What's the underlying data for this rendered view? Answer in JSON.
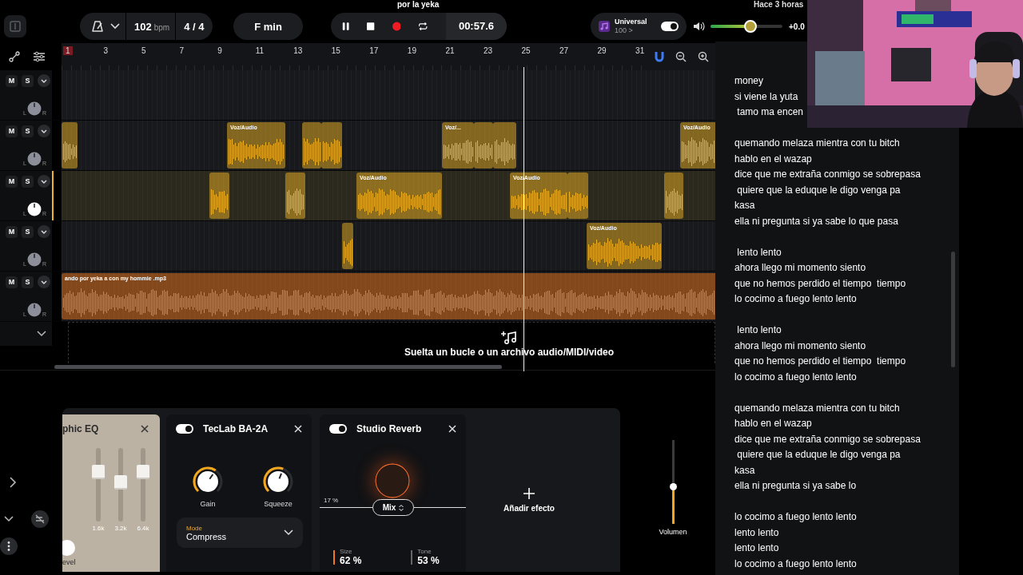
{
  "header": {
    "title": "por la yeka",
    "saved": "Hace 3 horas"
  },
  "toolbar": {
    "tempo": "102",
    "tempo_unit": "bpm",
    "time_signature": "4 / 4",
    "key": "F min",
    "playing": true,
    "time": "00:57.6",
    "preset": {
      "name": "Universal",
      "value": "100 >",
      "on": true
    },
    "master": {
      "level": 0.55,
      "reading": "+0.0"
    }
  },
  "ruler": {
    "marks": [
      {
        "label": "1",
        "highlighted": true
      },
      {
        "label": "3",
        "highlighted": false
      },
      {
        "label": "5",
        "highlighted": false
      },
      {
        "label": "7",
        "highlighted": false
      },
      {
        "label": "9",
        "highlighted": false
      },
      {
        "label": "11",
        "highlighted": false
      },
      {
        "label": "13",
        "highlighted": false
      },
      {
        "label": "15",
        "highlighted": false
      },
      {
        "label": "17",
        "highlighted": false
      },
      {
        "label": "19",
        "highlighted": false
      },
      {
        "label": "21",
        "highlighted": false
      },
      {
        "label": "23",
        "highlighted": false
      },
      {
        "label": "25",
        "highlighted": false
      },
      {
        "label": "27",
        "highlighted": false
      },
      {
        "label": "29",
        "highlighted": false
      },
      {
        "label": "31",
        "highlighted": false
      }
    ]
  },
  "tracks": [
    {
      "mute": "M",
      "solo": "S",
      "pan_left": "L",
      "pan_right": "R",
      "selected": false
    },
    {
      "mute": "M",
      "solo": "S",
      "pan_left": "L",
      "pan_right": "R",
      "selected": false,
      "color": "#f0b323",
      "clips": [
        {
          "kind": "clip"
        },
        {
          "kind": "clip",
          "label": "Voz/Audio"
        },
        {
          "kind": "clip"
        },
        {
          "kind": "clip"
        },
        {
          "kind": "clip",
          "label": "Voz/..."
        },
        {
          "kind": "clip"
        },
        {
          "kind": "clip"
        },
        {
          "kind": "clip",
          "label": "Voz/Audio"
        }
      ]
    },
    {
      "mute": "M",
      "solo": "S",
      "pan_left": "L",
      "pan_right": "R",
      "selected": true,
      "color": "#f0b323",
      "clips": [
        {
          "kind": "clip"
        },
        {
          "kind": "clip"
        },
        {
          "kind": "clip",
          "label": "Voz/Audio"
        },
        {
          "kind": "clip",
          "label": "Voz/Audio"
        },
        {
          "kind": "clip"
        },
        {
          "kind": "clip"
        }
      ]
    },
    {
      "mute": "M",
      "solo": "S",
      "pan_left": "L",
      "pan_right": "R",
      "selected": false,
      "color": "#f0b323",
      "clips": [
        {
          "kind": "clip"
        },
        {
          "kind": "clip",
          "label": "Voz/Audio"
        }
      ]
    },
    {
      "mute": "M",
      "solo": "S",
      "pan_left": "L",
      "pan_right": "R",
      "selected": false,
      "color": "#f07a1e",
      "clips": [
        {
          "kind": "clip",
          "label": "ando por yeka a con my hommie .mp3"
        }
      ]
    }
  ],
  "drop_zone": {
    "text": "Suelta un bucle o un archivo audio/MIDI/video"
  },
  "effects": [
    {
      "kind": "eq",
      "title": "phic EQ",
      "bands": [
        {
          "label": "1.6k",
          "level": 0.67
        },
        {
          "label": "3.2k",
          "level": 0.53
        },
        {
          "label": "6.4k",
          "level": 0.67
        }
      ],
      "knob_label": "evel"
    },
    {
      "kind": "compressor",
      "title": "TecLab BA-2A",
      "on": true,
      "knobs": [
        {
          "label": "Gain",
          "level": 0.63
        },
        {
          "label": "Squeeze",
          "level": 0.58
        }
      ],
      "mode": {
        "label": "Mode",
        "value": "Compress"
      }
    },
    {
      "kind": "reverb",
      "title": "Studio Reverb",
      "on": true,
      "mix": {
        "label": "Mix",
        "reading": "17 %"
      },
      "params": [
        {
          "label": "Size",
          "reading": "62 %",
          "selected": true
        },
        {
          "label": "Tone",
          "reading": "53 %",
          "selected": false
        }
      ]
    }
  ],
  "add_effect": {
    "label": "Añadir efecto"
  },
  "volume": {
    "label": "Volumen",
    "level": 0.44
  },
  "lyrics": {
    "stanzas": [
      [
        "money",
        "si viene la yuta",
        " tamo ma encen"
      ],
      [
        "quemando melaza mientra con tu bitch",
        "hablo en el wazap",
        "dice que me extraña conmigo se sobrepasa",
        " quiere que la eduque le digo venga pa",
        "kasa",
        "ella ni pregunta si ya sabe lo que pasa"
      ],
      [
        " lento lento",
        "ahora llego mi momento siento",
        "que no hemos perdido el tiempo  tiempo",
        "lo cocimo a fuego lento lento"
      ],
      [
        " lento lento",
        "ahora llego mi momento siento",
        "que no hemos perdido el tiempo  tiempo",
        "lo cocimo a fuego lento lento"
      ],
      [
        "quemando melaza mientra con tu bitch",
        "hablo en el wazap",
        "dice que me extraña conmigo se sobrepasa",
        " quiere que la eduque le digo venga pa",
        "kasa",
        "ella ni pregunta si ya sabe lo"
      ],
      [
        "lo cocimo a fuego lento lento",
        "lento lento",
        "lento lento",
        "lo cocimo a fuego lento lento"
      ]
    ]
  }
}
